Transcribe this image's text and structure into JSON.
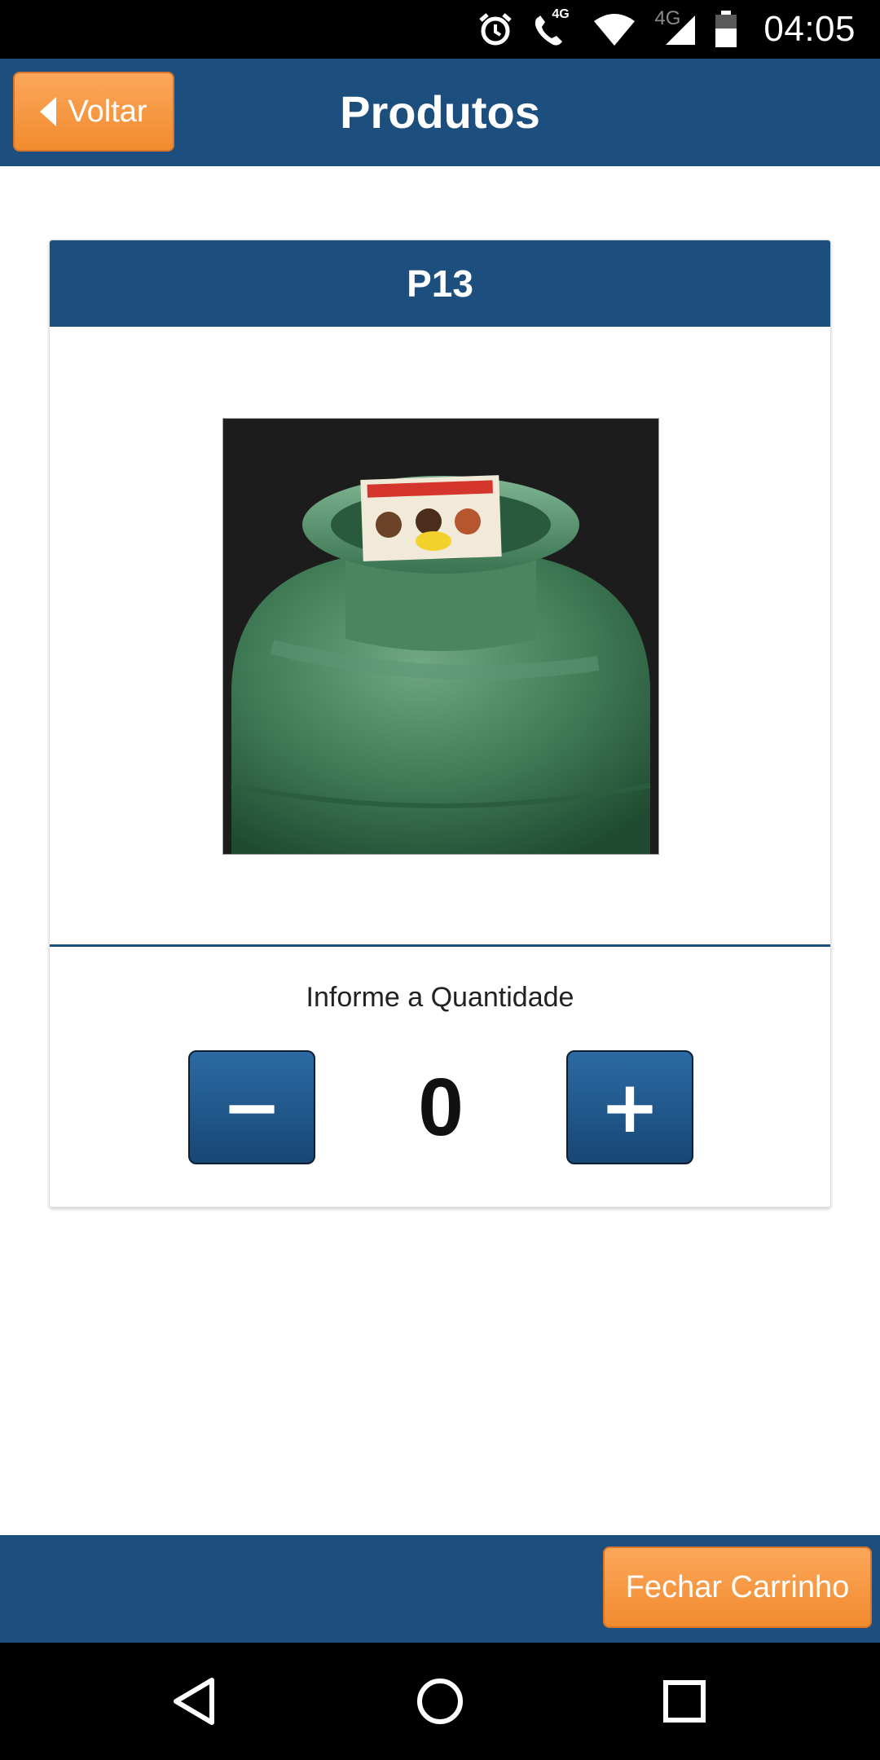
{
  "status_bar": {
    "time": "04:05",
    "signal_label": "4G",
    "call_label": "4G",
    "icons": [
      "alarm-icon",
      "wifi-calling-icon",
      "wifi-icon",
      "cell-signal-icon",
      "battery-icon"
    ]
  },
  "header": {
    "back_label": "Voltar",
    "back_icon": "caret-left-icon",
    "title": "Produtos",
    "accent_color": "#1d4f7e",
    "button_color": "#f7953f"
  },
  "product": {
    "name": "P13",
    "image": "gas-cylinder-image",
    "quantity_label": "Informe a Quantidade",
    "quantity": "0",
    "decrement_label": "−",
    "increment_label": "+"
  },
  "footer": {
    "checkout_label": "Fechar Carrinho"
  },
  "nav_bar": {
    "icons": [
      "back-triangle-icon",
      "home-circle-icon",
      "recents-square-icon"
    ]
  }
}
